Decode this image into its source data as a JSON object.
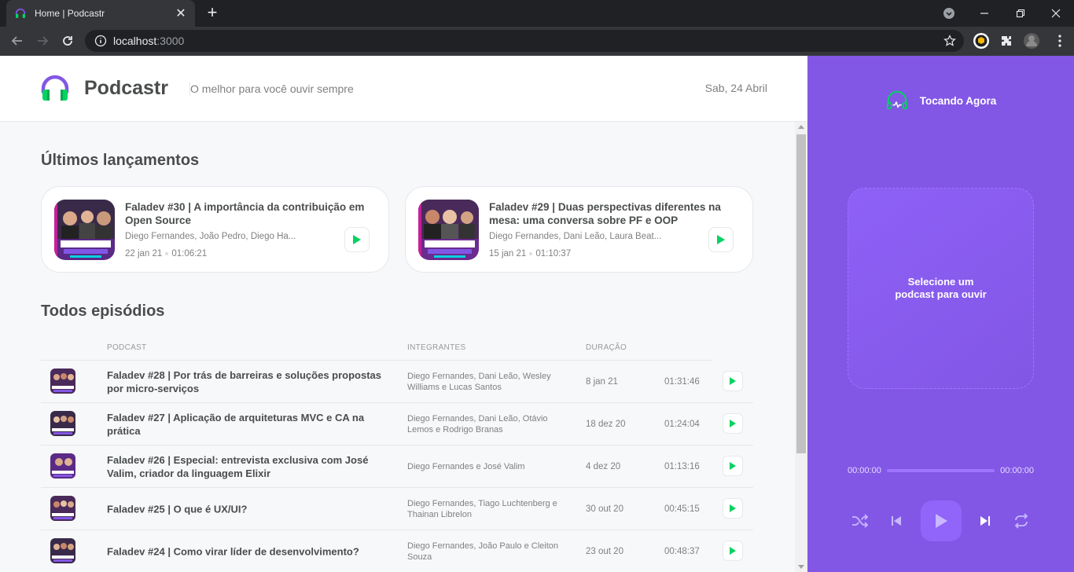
{
  "browser": {
    "tab_title": "Home | Podcastr",
    "url_host": "localhost",
    "url_port": ":3000"
  },
  "header": {
    "logo_text": "Podcastr",
    "tagline": "O melhor para você ouvir sempre",
    "date": "Sab, 24 Abril"
  },
  "latest": {
    "title": "Últimos lançamentos",
    "items": [
      {
        "title": "Faladev #30 | A importância da contribuição em Open Source",
        "members": "Diego Fernandes, João Pedro, Diego Ha...",
        "date": "22 jan 21",
        "duration": "01:06:21",
        "thumb_color": "#5b2a86"
      },
      {
        "title": "Faladev #29 | Duas perspectivas diferentes na mesa: uma conversa sobre PF e OOP",
        "members": "Diego Fernandes, Dani Leão, Laura Beat...",
        "date": "15 jan 21",
        "duration": "01:10:37",
        "thumb_color": "#6a2c8e"
      }
    ]
  },
  "episodes": {
    "title": "Todos episódios",
    "columns": {
      "podcast": "PODCAST",
      "members": "INTEGRANTES",
      "duration": "DURAÇÃO"
    },
    "rows": [
      {
        "title": "Faladev #28 | Por trás de barreiras e soluções propostas por micro-serviços",
        "members": "Diego Fernandes, Dani Leão, Wesley Williams e Lucas Santos",
        "date": "8 jan 21",
        "duration": "01:31:46"
      },
      {
        "title": "Faladev #27 | Aplicação de arquiteturas MVC e CA na prática",
        "members": "Diego Fernandes, Dani Leão, Otávio Lemos e Rodrigo Branas",
        "date": "18 dez 20",
        "duration": "01:24:04"
      },
      {
        "title": "Faladev #26 | Especial: entrevista exclusiva com José Valim, criador da linguagem Elixir",
        "members": "Diego Fernandes e José Valim",
        "date": "4 dez 20",
        "duration": "01:13:16"
      },
      {
        "title": "Faladev #25 | O que é UX/UI?",
        "members": "Diego Fernandes, Tiago Luchtenberg e Thainan Librelon",
        "date": "30 out 20",
        "duration": "00:45:15"
      },
      {
        "title": "Faladev #24 | Como virar líder de desenvolvimento?",
        "members": "Diego Fernandes, João Paulo e Cleiton Souza",
        "date": "23 out 20",
        "duration": "00:48:37"
      }
    ]
  },
  "player": {
    "heading": "Tocando Agora",
    "empty_text": "Selecione um podcast para ouvir",
    "time_current": "00:00:00",
    "time_total": "00:00:00",
    "progress": 0
  },
  "colors": {
    "purple": "#8257e5",
    "green": "#04d361",
    "text": "#494d4b"
  }
}
